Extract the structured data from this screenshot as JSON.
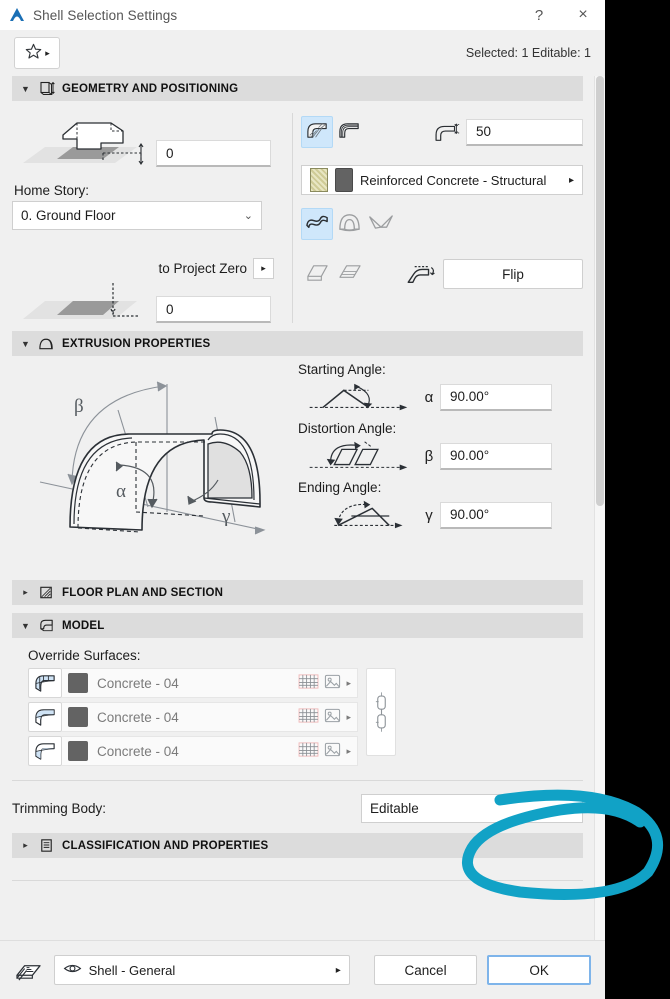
{
  "window": {
    "title": "Shell Selection Settings",
    "icon": "archicad-shell-icon",
    "help_label": "?",
    "close_label": "×"
  },
  "toolbar": {
    "favorites_icon": "star-icon",
    "favorites_arrow": "▸",
    "selection_info": "Selected: 1 Editable: 1"
  },
  "sections": {
    "geometry": {
      "title": "GEOMETRY AND POSITIONING",
      "icon": "geometry-positioning-icon",
      "expanded": true,
      "collapse_arrow": "▼",
      "elevation_value": "0",
      "elevation_icon": "shell-elevation-icon",
      "home_story_label": "Home Story:",
      "home_story_value": "0. Ground Floor",
      "home_story_chevron": "⌄",
      "to_project_zero_label": "to Project Zero",
      "to_project_zero_arrow": "▸",
      "project_zero_value": "0",
      "project_zero_icon": "project-zero-icon",
      "structure_toggles": [
        {
          "name": "basic-structure-icon",
          "selected": true
        },
        {
          "name": "composite-structure-icon",
          "selected": false
        }
      ],
      "thickness_icon": "thickness-icon",
      "thickness_value": "50",
      "material": {
        "name": "Reinforced Concrete - Structural",
        "hatch_swatch": "hatch-swatch",
        "color_swatch": "gray-swatch",
        "arrow": "▸"
      },
      "shell_type_toggles": [
        {
          "name": "extruded-shell-icon",
          "selected": true,
          "disabled": false
        },
        {
          "name": "revolved-shell-icon",
          "selected": false,
          "disabled": true
        },
        {
          "name": "ruled-shell-icon",
          "selected": false,
          "disabled": true
        }
      ],
      "edge_toggles": [
        {
          "name": "shell-edge-trim-icon",
          "disabled": true
        },
        {
          "name": "shell-edge-extend-icon",
          "disabled": true
        }
      ],
      "flip_icon": "flip-icon",
      "flip_label": "Flip"
    },
    "extrusion": {
      "title": "EXTRUSION PROPERTIES",
      "icon": "extrusion-properties-icon",
      "expanded": true,
      "collapse_arrow": "▼",
      "preview_icon": "shell-extrusion-diagram",
      "preview_labels": {
        "alpha": "α",
        "beta": "β",
        "gamma": "γ"
      },
      "angles": [
        {
          "label": "Starting Angle:",
          "symbol": "α",
          "value": "90.00°",
          "icon": "starting-angle-icon"
        },
        {
          "label": "Distortion Angle:",
          "symbol": "β",
          "value": "90.00°",
          "icon": "distortion-angle-icon"
        },
        {
          "label": "Ending Angle:",
          "symbol": "γ",
          "value": "90.00°",
          "icon": "ending-angle-icon"
        }
      ]
    },
    "floor_plan": {
      "title": "FLOOR PLAN AND SECTION",
      "icon": "floor-plan-section-icon",
      "expanded": false,
      "collapse_arrow": "▸"
    },
    "model": {
      "title": "MODEL",
      "icon": "model-icon",
      "expanded": true,
      "collapse_arrow": "▼",
      "override_surfaces_label": "Override Surfaces:",
      "surfaces": [
        {
          "icon": "shell-surface-all-icon",
          "name": "Concrete - 04",
          "grid_icon": "pattern-icon",
          "picture_icon": "texture-icon",
          "arrow": "▸"
        },
        {
          "icon": "shell-surface-top-icon",
          "name": "Concrete - 04",
          "grid_icon": "pattern-icon",
          "picture_icon": "texture-icon",
          "arrow": "▸"
        },
        {
          "icon": "shell-surface-bottom-icon",
          "name": "Concrete - 04",
          "grid_icon": "pattern-icon",
          "picture_icon": "texture-icon",
          "arrow": "▸"
        }
      ],
      "chain_icon": "chain-link-icon",
      "trimming_body_label": "Trimming Body:",
      "trimming_body_value": "Editable",
      "trimming_body_chevron": "⌄"
    },
    "classification": {
      "title": "CLASSIFICATION AND PROPERTIES",
      "icon": "classification-properties-icon",
      "expanded": false,
      "collapse_arrow": "▸"
    }
  },
  "footer": {
    "layer_icon": "layers-icon",
    "eye_icon": "eye-icon",
    "layer_value": "Shell - General",
    "layer_arrow": "▸",
    "cancel_label": "Cancel",
    "ok_label": "OK"
  },
  "annotation": {
    "name": "teal-highlight-ellipse",
    "color": "#11a2c6",
    "target": "trimming-body-dropdown"
  },
  "colors": {
    "dialog_bg": "#f0f0f0",
    "section_header": "#dcdcdc",
    "accent_selected": "#cfe7fb",
    "annotation": "#11a2c6",
    "background": "#000000"
  }
}
